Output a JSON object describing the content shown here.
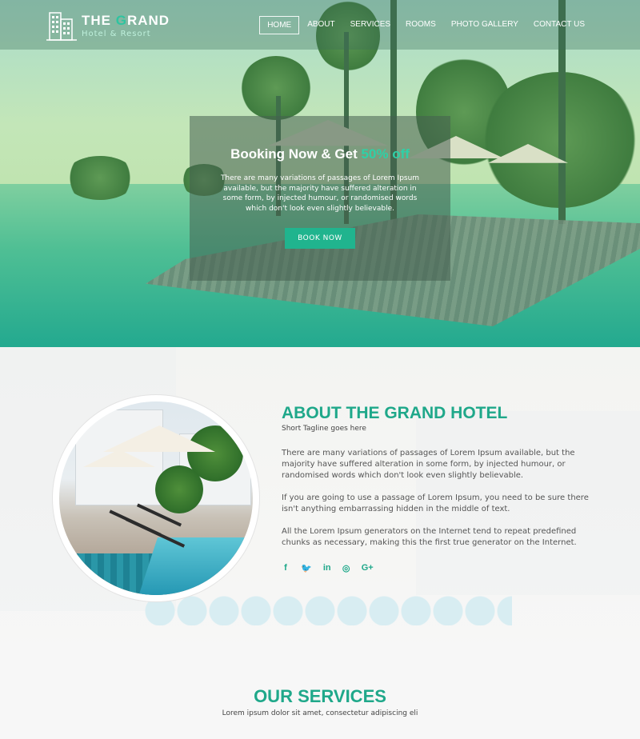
{
  "brand": {
    "title_pre": "THE ",
    "title_g": "G",
    "title_post": "RAND",
    "subtitle": "Hotel & Resort"
  },
  "nav": {
    "items": [
      {
        "label": "HOME",
        "active": true
      },
      {
        "label": "ABOUT"
      },
      {
        "label": "SERVICES"
      },
      {
        "label": "ROOMS"
      },
      {
        "label": "PHOTO GALLERY"
      },
      {
        "label": "CONTACT US"
      }
    ]
  },
  "hero": {
    "headline_pre": "Booking Now & Get ",
    "headline_highlight": "50% off",
    "text": "There are many variations of passages of Lorem Ipsum available, but the majority have suffered alteration in some form, by injected humour, or randomised words which don't look even slightly believable.",
    "button_label": "BOOK NOW"
  },
  "about": {
    "title": "ABOUT THE GRAND HOTEL",
    "tagline": "Short Tagline goes here",
    "paragraphs": [
      "There are many variations of passages of Lorem Ipsum available, but the majority have suffered alteration in some form, by injected humour, or randomised words which don't look even slightly believable.",
      "If you are going to use a passage of Lorem Ipsum, you need to be sure there isn't anything embarrassing hidden in the middle of text.",
      "All the Lorem Ipsum generators on the Internet tend to repeat predefined chunks as necessary, making this the first true generator on the Internet."
    ],
    "social": {
      "facebook": "f",
      "twitter": "🐦",
      "linkedin": "in",
      "instagram": "◎",
      "googleplus": "G+"
    }
  },
  "services": {
    "title": "OUR SERVICES",
    "subtitle": "Lorem ipsum dolor sit amet, consectetur adipiscing eli"
  },
  "colors": {
    "accent": "#1fa88a",
    "button": "#20b48e"
  }
}
